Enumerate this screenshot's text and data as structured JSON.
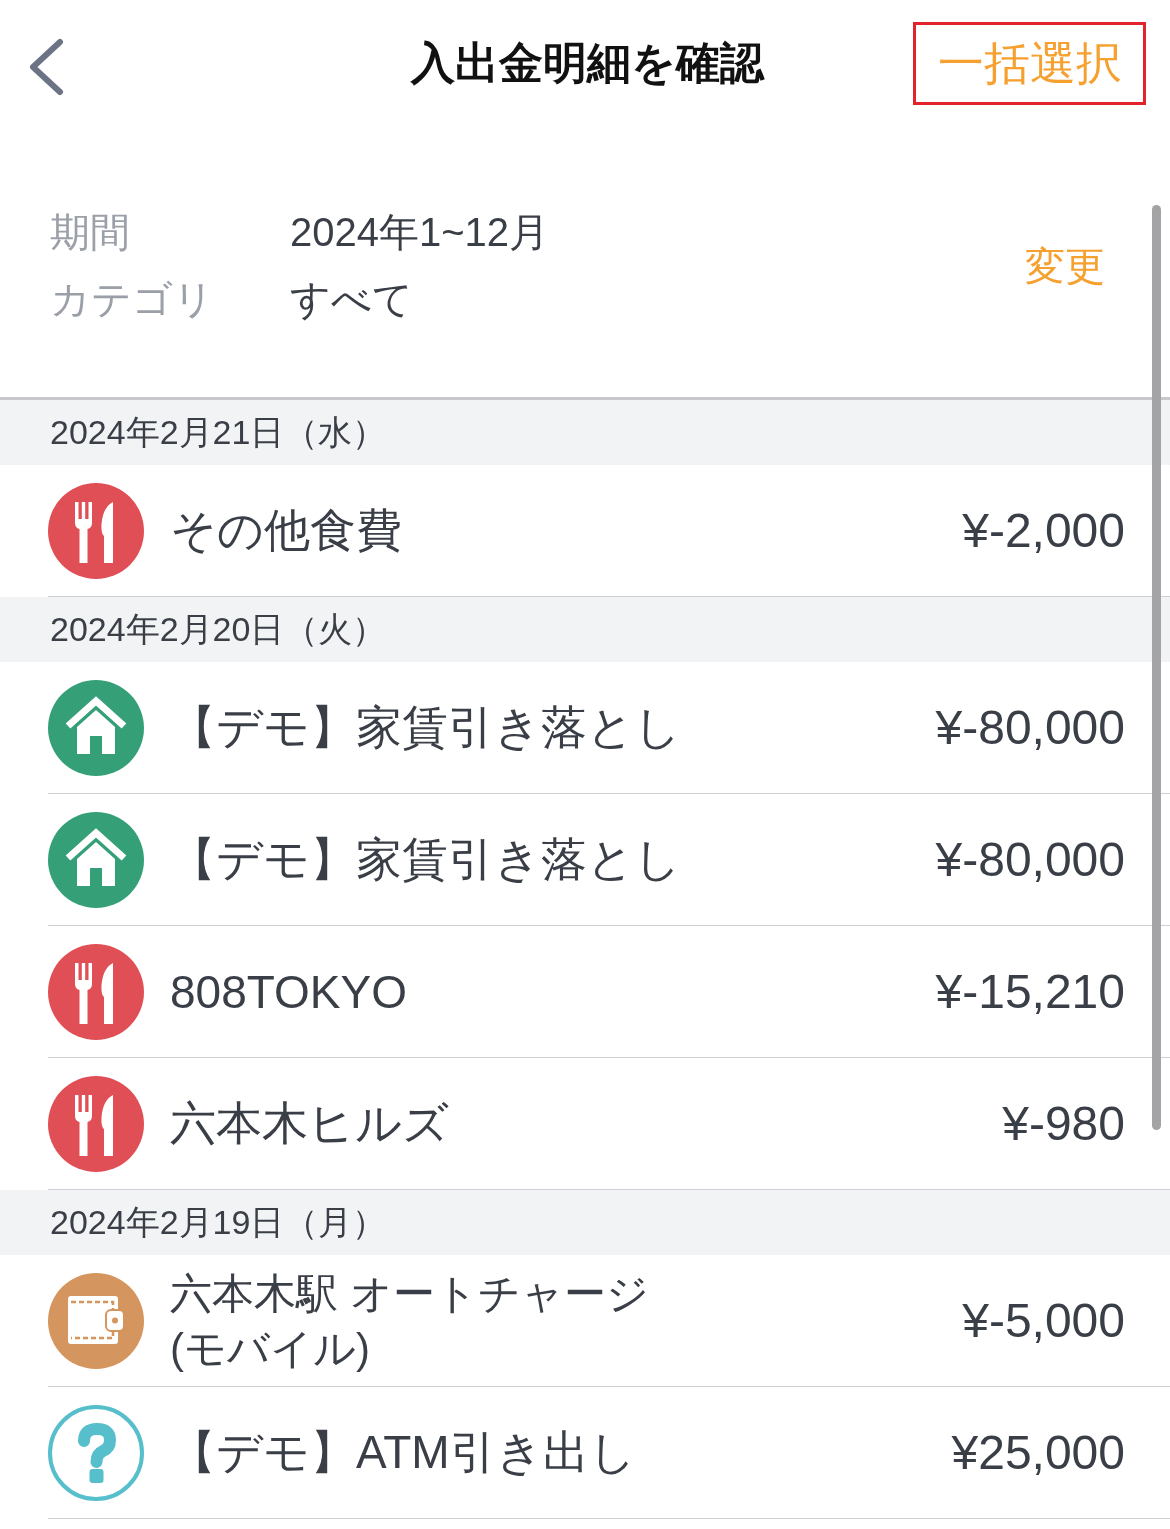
{
  "header": {
    "title": "入出金明細を確認",
    "action": "一括選択"
  },
  "filter": {
    "rows": [
      {
        "label": "期間",
        "value": "2024年1~12月"
      },
      {
        "label": "カテゴリ",
        "value": "すべて"
      }
    ],
    "change": "変更"
  },
  "sections": [
    {
      "date": "2024年2月21日（水）",
      "transactions": [
        {
          "kind": "food",
          "color": "#e04f55",
          "name": "その他食費",
          "amount": "¥-2,000"
        }
      ]
    },
    {
      "date": "2024年2月20日（火）",
      "transactions": [
        {
          "kind": "home",
          "color": "#35a077",
          "name": "【デモ】家賃引き落とし",
          "amount": "¥-80,000"
        },
        {
          "kind": "home",
          "color": "#35a077",
          "name": "【デモ】家賃引き落とし",
          "amount": "¥-80,000"
        },
        {
          "kind": "food",
          "color": "#e04f55",
          "name": "808TOKYO",
          "amount": "¥-15,210"
        },
        {
          "kind": "food",
          "color": "#e04f55",
          "name": "六本木ヒルズ",
          "amount": "¥-980"
        }
      ]
    },
    {
      "date": "2024年2月19日（月）",
      "transactions": [
        {
          "kind": "wallet",
          "color": "#d4955e",
          "name": "六本木駅 オートチャージ(モバイル)",
          "amount": "¥-5,000"
        },
        {
          "kind": "unknown",
          "color": "#56bfcb",
          "name": "【デモ】ATM引き出し",
          "amount": "¥25,000"
        }
      ]
    }
  ]
}
